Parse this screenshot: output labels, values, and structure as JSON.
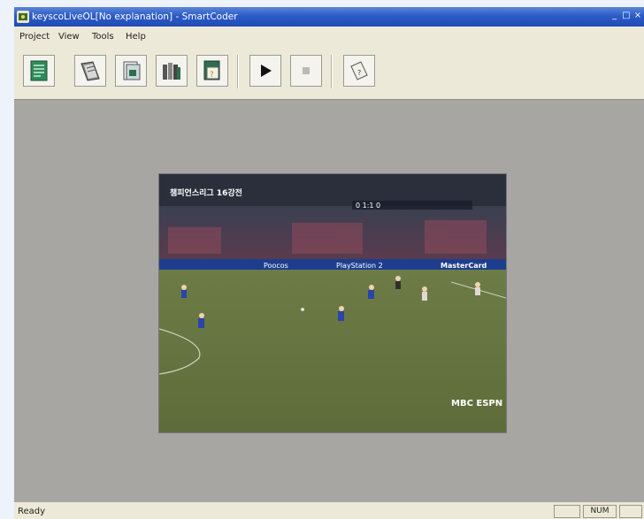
{
  "window": {
    "title": "keyscoLiveOL[No explanation] - SmartCoder",
    "controls": {
      "minimize": "_",
      "maximize": "□",
      "close": "×"
    }
  },
  "menu": [
    "Project",
    "View",
    "Tools",
    "Help"
  ],
  "toolbar": {
    "buttons": [
      {
        "icon": "new-document-icon"
      },
      {
        "icon": "open-document-icon"
      },
      {
        "icon": "save-document-icon"
      },
      {
        "icon": "library-icon"
      },
      {
        "icon": "properties-icon"
      },
      {
        "icon": "play-icon"
      },
      {
        "icon": "stop-icon"
      },
      {
        "icon": "help-icon"
      }
    ]
  },
  "video": {
    "caption": "챔피언스리그 16강전",
    "score": "0 1:1 0",
    "ad_board_1": "Poocos",
    "ad_board_2": "PlayStation 2",
    "ad_board_3": "MasterCard",
    "broadcaster": "MBC ESPN"
  },
  "status": {
    "text": "Ready",
    "num": "NUM"
  }
}
